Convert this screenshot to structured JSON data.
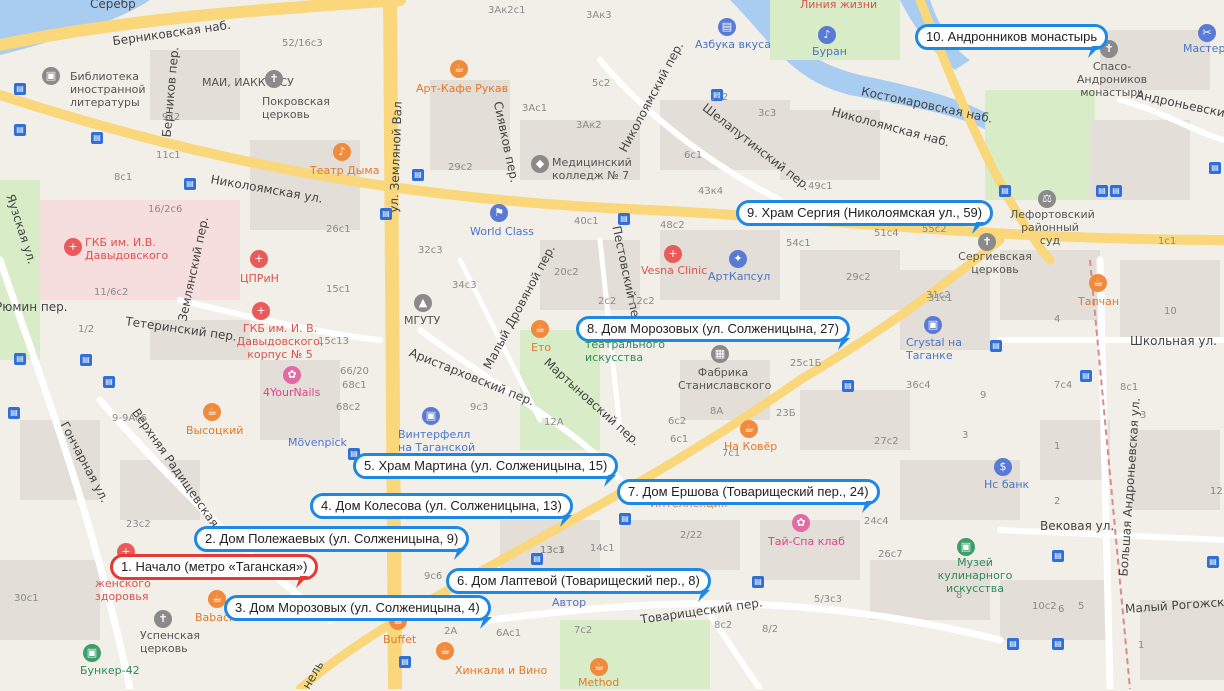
{
  "route_points": [
    {
      "label": "1. Начало (метро «Таганская»)",
      "kind": "start"
    },
    {
      "label": "2. Дом Полежаевых (ул. Солженицына, 9)",
      "kind": "stop"
    },
    {
      "label": "3. Дом Морозовых (ул. Солженицына, 4)",
      "kind": "stop"
    },
    {
      "label": "4. Дом Колесова (ул. Солженицына, 13)",
      "kind": "stop"
    },
    {
      "label": "5. Храм Мартина (ул. Солженицына, 15)",
      "kind": "stop"
    },
    {
      "label": "6. Дом Лаптевой (Товарищеский пер., 8)",
      "kind": "stop"
    },
    {
      "label": "7. Дом Ершова (Товарищеский пер., 24)",
      "kind": "stop"
    },
    {
      "label": "8. Дом Морозовых (ул. Солженицына, 27)",
      "kind": "stop"
    },
    {
      "label": "9. Храм Сергия (Николоямская ул., 59)",
      "kind": "stop"
    },
    {
      "label": "10. Андронников монастырь",
      "kind": "stop"
    }
  ],
  "streets": {
    "serebr": "Серебр",
    "bernikovskaya": "Берниковская наб.",
    "zemlyanoy_val": "ул. Земляной Вал",
    "nikoloyamskaya_w": "Николоямская ул.",
    "nikoloyamskaya_nab": "Николоямская наб.",
    "kostomarovskaya": "Костомаровская наб.",
    "yauzskaya": "Яузская ул.",
    "zemlyanskiy": "Землянский пер.",
    "teterinskiy": "Тетеринский пер.",
    "ryumin": "Рюмин пер.",
    "verkhnyaya_radish": "Верхняя Радищевская ул.",
    "goncharnaya": "Гончарная ул.",
    "aristarkhovskiy": "Аристарховский пер.",
    "malyy_drovyanoy": "Малый Дровяной пер.",
    "pestovskiy": "Пестовский пер.",
    "martynovskiy": "Мартыновский пер.",
    "syavskoy": "Сиявков пер.",
    "nikolayevskiy": "Николоямский пер.",
    "shelaputinskiy": "Шелапутинский пер.",
    "bolshaya_andron": "Большая Андроньевская ул.",
    "andronevskiy": "Андроньевский пр.",
    "shkolnaya": "Школьная ул.",
    "vekovaya": "Вековая ул.",
    "malyy_rogozhskiy": "Малый Рогожский",
    "tovarishcheskiy": "Товарищеский пер.",
    "berniko": "Берников пер.",
    "nel": "нель"
  },
  "pois": {
    "biblioteka": "Библиотека иностранной литературы",
    "mai": "МАИ, ИАККТиСУ",
    "pokrovskaya": "Покровская церковь",
    "art_cafe": "Арт-Кафе Рукав",
    "teatr_dyma": "Театр Дыма",
    "azbuka": "Азбука вкуса",
    "buran": "Буран",
    "liniya": "Линия жизни",
    "spaso": "Спасо-Андроников монастырь",
    "master": "Мастер",
    "med_college": "Медицинский колледж № 7",
    "world_class": "World Class",
    "vesna": "Vesna Clinic",
    "artkapsul": "АртКапсул",
    "gkb1": "ГКБ им. И.В. Давыдовского",
    "cprin": "ЦПРиН",
    "gkb2": "ГКБ им. И. В. Давыдовского, корпус № 5",
    "nails": "4YourNails",
    "mgutu": "МГУТУ",
    "eto": "Ето",
    "teatralnogo": "театрального искусства",
    "fabrika": "Фабрика Станиславского",
    "crystal": "Crystal на Таганке",
    "sergievskaya": "Сергиевская церковь",
    "lefortovskiy": "Лефортовский районный суд",
    "tapchan": "Тапчан",
    "vysotskiy": "Высоцкий",
    "movenpick": "Mövenpick",
    "vintefell": "Винтерфелл на Таганской",
    "na_kover": "На Ковёр",
    "ns_bank": "Нс банк",
    "intellectual": "Интеллекция",
    "tai_spa": "Тай-Спа клаб",
    "muzey": "Музей кулинарного искусства",
    "avtor": "Автор",
    "zhenskogo": "женского здоровья",
    "babachi": "Babach",
    "uspenskaya": "Успенская церковь",
    "bunker": "Бункер-42",
    "buffet": "Buffet",
    "khinkali": "Хинкали и Вино",
    "method": "Method"
  },
  "house_numbers": [
    "3Ак2с1",
    "3Ак3",
    "52/16с3",
    "9с2",
    "3Ас1",
    "3Ак2",
    "3с3",
    "5с2",
    "6с1",
    "1с2",
    "49с1",
    "43к4",
    "40с1",
    "48с2",
    "54с1",
    "20с2",
    "29с2",
    "55с2",
    "51с4",
    "26с1",
    "32с3",
    "34с3",
    "29с2",
    "31с2",
    "36с4",
    "13с1",
    "25с1Б",
    "23Б",
    "8А",
    "6с2",
    "7с1",
    "8с2",
    "24с4",
    "26с7",
    "5/3с3",
    "10с2",
    "13с3",
    "14с1",
    "2/22",
    "6Ас1",
    "2А",
    "7с2",
    "9с6",
    "30с1",
    "23с2",
    "9-9Ас6",
    "1/2",
    "16/2с6",
    "11/6с2",
    "11с1",
    "8с1",
    "15с1",
    "15с13",
    "66/20",
    "68с2",
    "68с1",
    "9с3",
    "12А",
    "12с2",
    "6с1",
    "8/2",
    "8",
    "5",
    "6",
    "7с4",
    "4",
    "3",
    "2",
    "8с1",
    "9",
    "31с1",
    "2с2",
    "1с1",
    "27с2",
    "3",
    "1",
    "10",
    "12",
    "1"
  ],
  "colors": {
    "accent_route": "#1e88e5",
    "start_route": "#e53935",
    "water": "#a9cdf0",
    "park": "#d8ecc7",
    "road_major": "#f9d77a"
  }
}
